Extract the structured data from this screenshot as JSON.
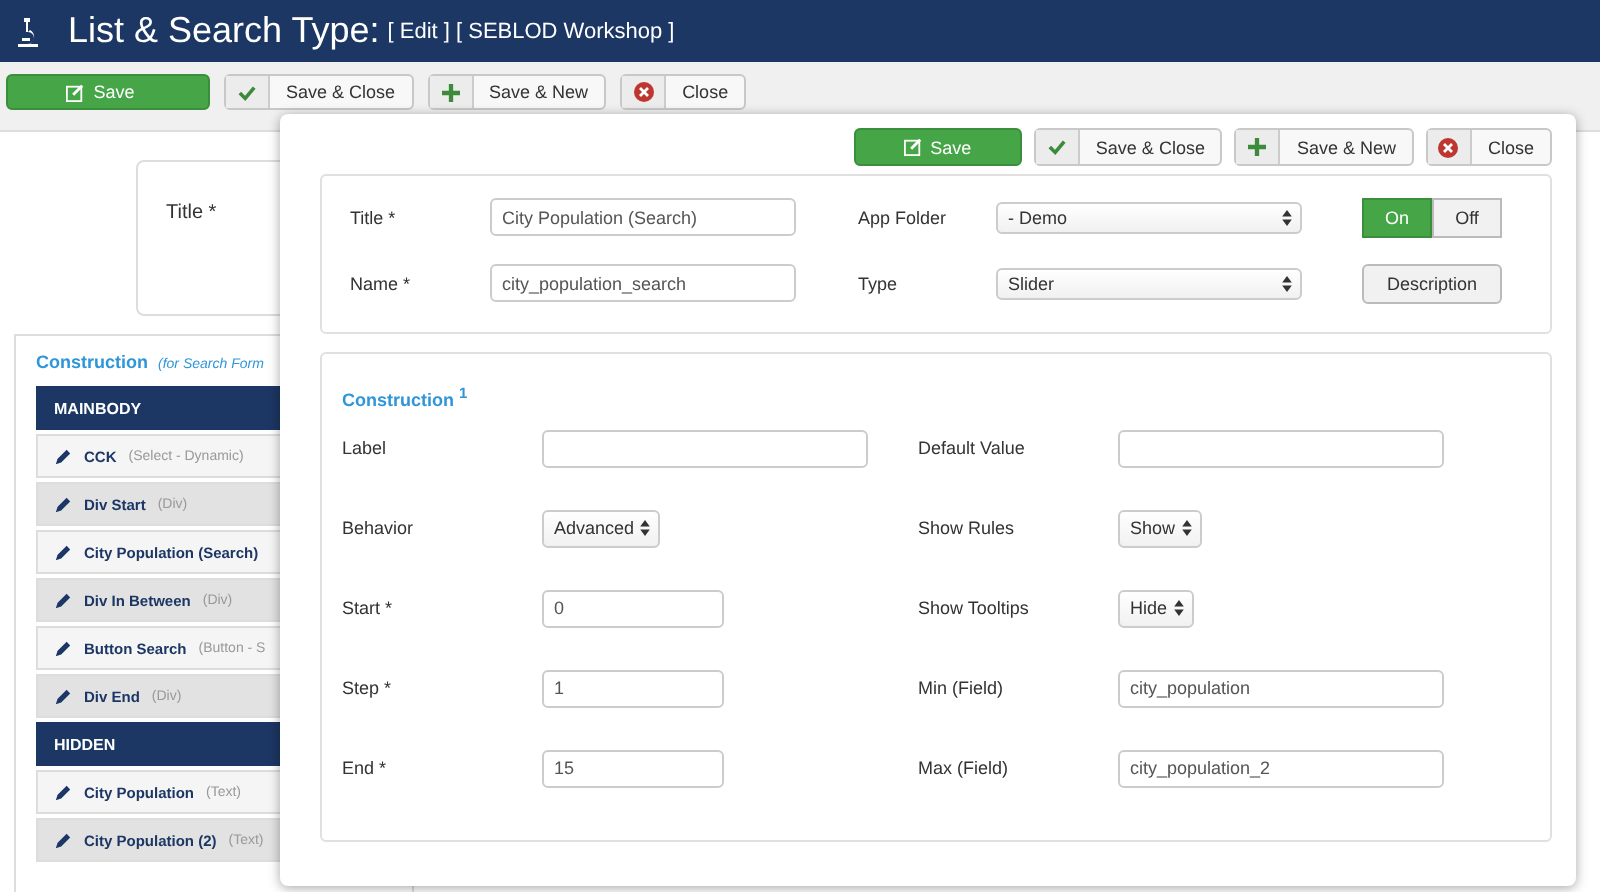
{
  "header": {
    "title": "List & Search Type:",
    "subtitle": "[ Edit ] [ SEBLOD Workshop ]"
  },
  "toolbar": [
    {
      "kind": "save",
      "label": "Save"
    },
    {
      "kind": "check",
      "label": "Save & Close"
    },
    {
      "kind": "plus",
      "label": "Save & New"
    },
    {
      "kind": "close",
      "label": "Close"
    }
  ],
  "title_card": {
    "label": "Title *"
  },
  "construction": {
    "title": "Construction",
    "note": "(for Search Form",
    "groups": [
      {
        "name": "MAINBODY",
        "items": [
          {
            "name": "CCK",
            "type": "(Select - Dynamic)"
          },
          {
            "name": "Div Start",
            "type": "(Div)"
          },
          {
            "name": "City Population (Search)"
          },
          {
            "name": "Div In Between",
            "type": "(Div)"
          },
          {
            "name": "Button Search",
            "type": "(Button - S"
          },
          {
            "name": "Div End",
            "type": "(Div)"
          }
        ]
      },
      {
        "name": "HIDDEN",
        "items": [
          {
            "name": "City Population",
            "type": "(Text)"
          },
          {
            "name": "City Population (2)",
            "type": "(Text)"
          }
        ]
      }
    ]
  },
  "modal": {
    "toolbar": [
      {
        "kind": "save",
        "label": "Save"
      },
      {
        "kind": "check",
        "label": "Save & Close"
      },
      {
        "kind": "plus",
        "label": "Save & New"
      },
      {
        "kind": "close",
        "label": "Close"
      }
    ],
    "general": {
      "rows": [
        {
          "label": "Title *",
          "value": "City Population (Search)",
          "label2": "App Folder",
          "select": "- Demo",
          "toggle": [
            {
              "label": "On",
              "selected": true
            },
            {
              "label": "Off",
              "selected": false
            }
          ]
        },
        {
          "label": "Name *",
          "value": "city_population_search",
          "label2": "Type",
          "select": "Slider",
          "button": "Description"
        }
      ]
    },
    "construction": {
      "title": "Construction $^{1}$",
      "rows": [
        {
          "label": "Label",
          "field": {
            "kind": "input"
          },
          "label2": "Default Value",
          "field2": {
            "kind": "input"
          }
        },
        {
          "label": "Behavior",
          "field": {
            "kind": "select",
            "value": "Advanced"
          },
          "label2": "Show Rules",
          "field2": {
            "kind": "select",
            "value": "Show"
          }
        },
        {
          "label": "Start *",
          "field": {
            "kind": "number",
            "value": "0"
          },
          "label2": "Show Tooltips",
          "field2": {
            "kind": "select",
            "value": "Hide"
          }
        },
        {
          "label": "Step *",
          "field": {
            "kind": "number",
            "value": "1"
          },
          "label2": "Min (Field)",
          "field2": {
            "kind": "input",
            "value": "city_population"
          }
        },
        {
          "label": "End *",
          "field": {
            "kind": "number",
            "value": "15"
          },
          "label2": "Max (Field)",
          "field2": {
            "kind": "input",
            "value": "city_population_2"
          }
        }
      ]
    }
  }
}
